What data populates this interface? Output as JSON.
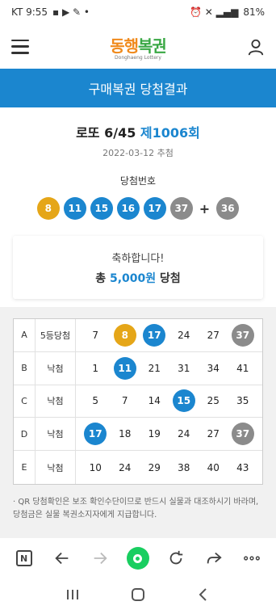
{
  "status_bar": {
    "carrier_time": "KT 9:55",
    "battery": "81%"
  },
  "header": {
    "logo_text_a": "동행",
    "logo_text_b": "복권",
    "logo_sub": "Donghaeng Lottery"
  },
  "banner": {
    "title": "구매복권 당첨결과"
  },
  "draw": {
    "game": "로또 6/45",
    "round": "제1006회",
    "date": "2022-03-12 추첨",
    "numbers_label": "당첨번호",
    "numbers": [
      8,
      11,
      15,
      16,
      17,
      37
    ],
    "bonus": 36,
    "plus": "+"
  },
  "result": {
    "congrats": "축하합니다!",
    "prefix": "총",
    "amount": "5,000원",
    "suffix": "당첨"
  },
  "ticket": [
    {
      "game": "A",
      "status": "5등당첨",
      "numbers": [
        7,
        8,
        17,
        24,
        27,
        37
      ]
    },
    {
      "game": "B",
      "status": "낙첨",
      "numbers": [
        1,
        11,
        21,
        31,
        34,
        41
      ]
    },
    {
      "game": "C",
      "status": "낙첨",
      "numbers": [
        5,
        7,
        14,
        15,
        25,
        35
      ]
    },
    {
      "game": "D",
      "status": "낙첨",
      "numbers": [
        17,
        18,
        19,
        24,
        27,
        37
      ]
    },
    {
      "game": "E",
      "status": "낙첨",
      "numbers": [
        10,
        24,
        29,
        38,
        40,
        43
      ]
    }
  ],
  "notice": "· QR 당첨확인은 보조 확인수단이므로 반드시 실물과 대조하시기 바라며, 당첨금은 실물 복권소지자에게 지급합니다.",
  "browser": {
    "n_label": "N"
  },
  "colors": {
    "primary": "#1b86cf",
    "ball_yellow": "#e5a618",
    "ball_blue": "#1b86cf",
    "ball_gray": "#8b8b8b",
    "logo_green": "#19ce60"
  }
}
